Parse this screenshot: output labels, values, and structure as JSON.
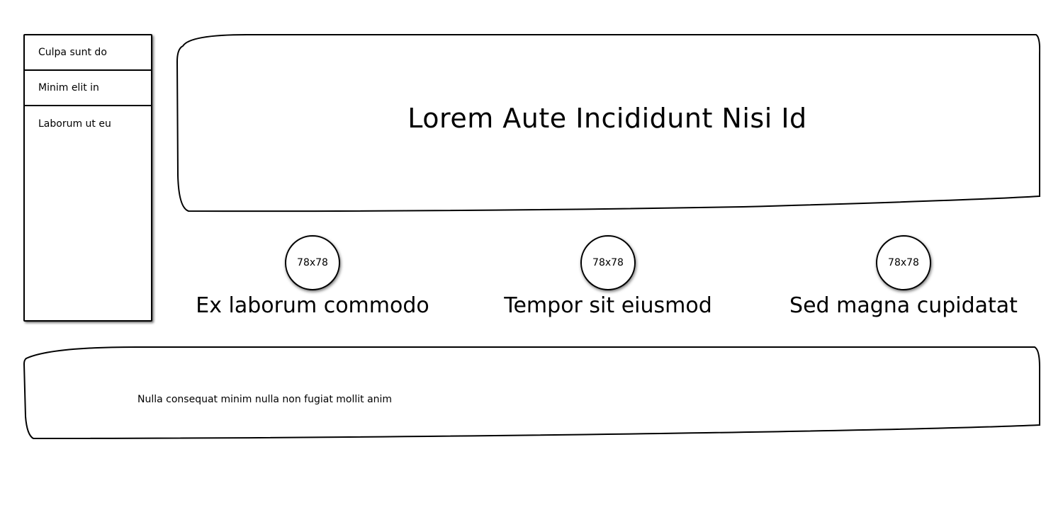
{
  "sidebar": {
    "items": [
      {
        "label": "Culpa sunt do"
      },
      {
        "label": "Minim elit in"
      },
      {
        "label": "Laborum ut eu"
      }
    ]
  },
  "hero": {
    "title": "Lorem Aute Incididunt Nisi Id"
  },
  "features": [
    {
      "image_label": "78x78",
      "label": "Ex laborum commodo"
    },
    {
      "image_label": "78x78",
      "label": "Tempor sit eiusmod"
    },
    {
      "image_label": "78x78",
      "label": "Sed magna cupidatat"
    }
  ],
  "footer": {
    "text": "Nulla consequat minim nulla non fugiat mollit anim"
  }
}
